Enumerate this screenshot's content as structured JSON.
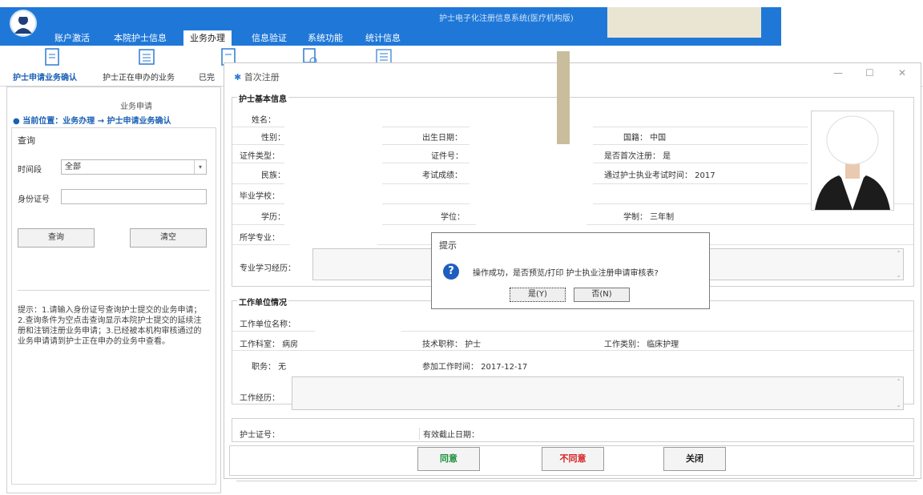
{
  "app": {
    "title": "护士电子化注册信息系统(医疗机构版)"
  },
  "nav": {
    "tabs": [
      "账户激活",
      "本院护士信息",
      "业务办理",
      "信息验证",
      "系统功能",
      "统计信息"
    ]
  },
  "toolbar": {
    "items": [
      "护士申请业务确认",
      "护士正在申办的业务",
      "已完"
    ]
  },
  "left": {
    "header": "业务申请",
    "location": "当前位置：业务办理 → 护士申请业务确认",
    "query_title": "查询",
    "period_label": "时间段",
    "period_value": "全部",
    "id_label": "身份证号",
    "id_value": "",
    "query_button": "查询",
    "clear_button": "清空",
    "tip": "提示：1.请输入身份证号查询护士提交的业务申请；2.查询条件为空点击查询显示本院护士提交的延续注册和注销注册业务申请；3.已经被本机构审核通过的业务申请请到护士正在申办的业务中查看。"
  },
  "dialog": {
    "title": "首次注册",
    "basic": {
      "section_title": "护士基本信息",
      "name_label": "姓名：",
      "gender_label": "性别：",
      "birth_label": "出生日期：",
      "nationality": "国籍：  中国",
      "idtype_label": "证件类型：",
      "idno_label": "证件号：",
      "first_reg": "是否首次注册：  是",
      "ethnic_label": "民族：",
      "score_label": "考试成绩：",
      "passtime": "通过护士执业考试时间：  2017",
      "school_label": "毕业学校：",
      "edu_label": "学历：",
      "degree_label": "学位：",
      "schooling": "学制：  三年制",
      "major_label": "所学专业：",
      "study_label": "专业学习经历："
    },
    "work": {
      "section_title": "工作单位情况",
      "unit_label": "工作单位名称：",
      "dept": "工作科室：  病房",
      "title": "技术职称：  护士",
      "category": "工作类别：  临床护理",
      "post": "职务：  无",
      "join_time": "参加工作时间：  2017-12-17",
      "history_label": "工作经历："
    },
    "cert": {
      "cert_label": "护士证号：",
      "expiry_label": "有效截止日期："
    },
    "buttons": {
      "agree": "同意",
      "disagree": "不同意",
      "close": "关闭"
    }
  },
  "message_box": {
    "title": "提示",
    "text": "操作成功，是否预览/打印 护士执业注册申请审核表?",
    "yes": "是(Y)",
    "no": "否(N)"
  },
  "colors": {
    "nav_blue": "#1f78d8",
    "agree_green": "#1a8f3a",
    "disagree_red": "#d42020",
    "location_blue": "#1a5fb4"
  }
}
